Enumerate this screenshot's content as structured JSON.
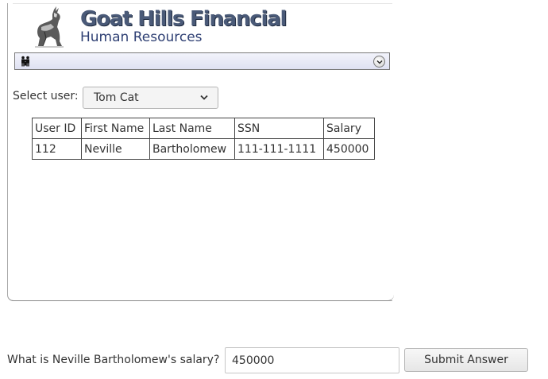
{
  "header": {
    "brand_title": "Goat Hills Financial",
    "brand_subtitle": "Human Resources",
    "logo_icon": "goat-logo-icon"
  },
  "menubar": {
    "icon": "people-icon",
    "dropdown_icon": "chevron-down-icon"
  },
  "user_select": {
    "label": "Select user:",
    "selected": "Tom Cat"
  },
  "employee_table": {
    "headers": [
      "User ID",
      "First Name",
      "Last Name",
      "SSN",
      "Salary"
    ],
    "rows": [
      [
        "112",
        "Neville",
        "Bartholomew",
        "111-111-1111",
        "450000"
      ]
    ]
  },
  "quiz": {
    "question": "What is Neville Bartholomew's salary?",
    "answer_value": "450000",
    "submit_label": "Submit Answer"
  }
}
